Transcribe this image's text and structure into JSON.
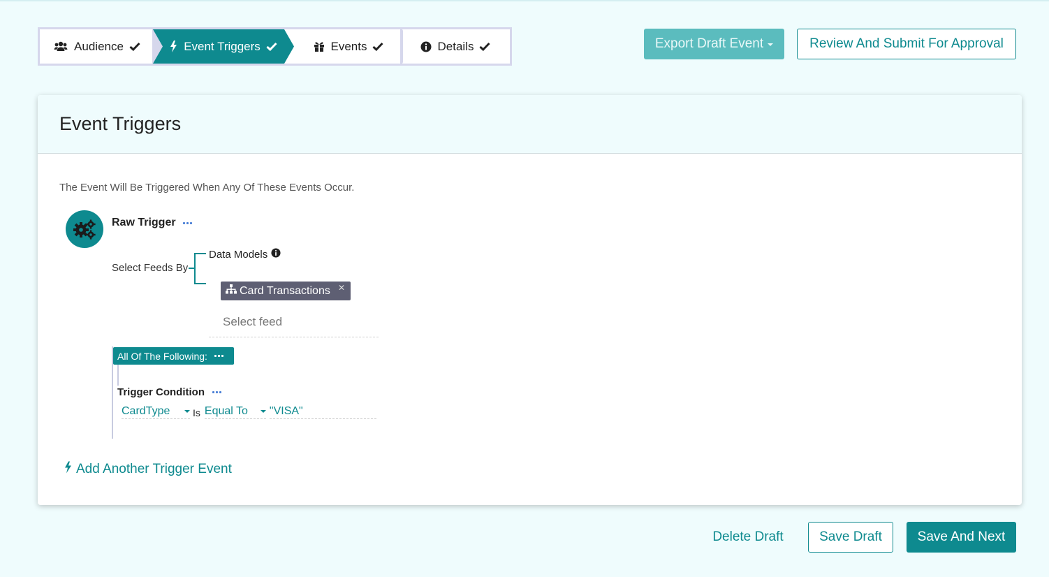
{
  "stepper": {
    "steps": [
      {
        "label": "Audience",
        "icon": "users-icon",
        "completed": true,
        "active": false
      },
      {
        "label": "Event Triggers",
        "icon": "bolt-icon",
        "completed": true,
        "active": true
      },
      {
        "label": "Events",
        "icon": "gift-icon",
        "completed": true,
        "active": false
      },
      {
        "label": "Details",
        "icon": "info-icon",
        "completed": true,
        "active": false
      }
    ]
  },
  "toolbar": {
    "export_label": "Export Draft Event",
    "review_label": "Review And Submit For Approval"
  },
  "card": {
    "title": "Event Triggers",
    "intro": "The Event Will Be Triggered When Any Of These Events Occur.",
    "trigger": {
      "title": "Raw Trigger",
      "select_feeds_label": "Select Feeds By",
      "data_models_label": "Data Models",
      "selected_feed": "Card Transactions",
      "feed_placeholder": "Select feed",
      "group_label": "All Of The Following:",
      "condition": {
        "title": "Trigger Condition",
        "field": "CardType",
        "is_label": "Is",
        "operator": "Equal To",
        "value": "\"VISA\""
      }
    },
    "add_trigger_label": "Add Another Trigger Event"
  },
  "footer": {
    "delete_label": "Delete Draft",
    "save_label": "Save Draft",
    "next_label": "Save And Next"
  },
  "colors": {
    "accent": "#0e8a8f",
    "accent_light": "#5bbcbe",
    "page_bg": "#effcfd",
    "chip_bg": "#5e5f73",
    "link_dots": "#4a7fd6"
  }
}
